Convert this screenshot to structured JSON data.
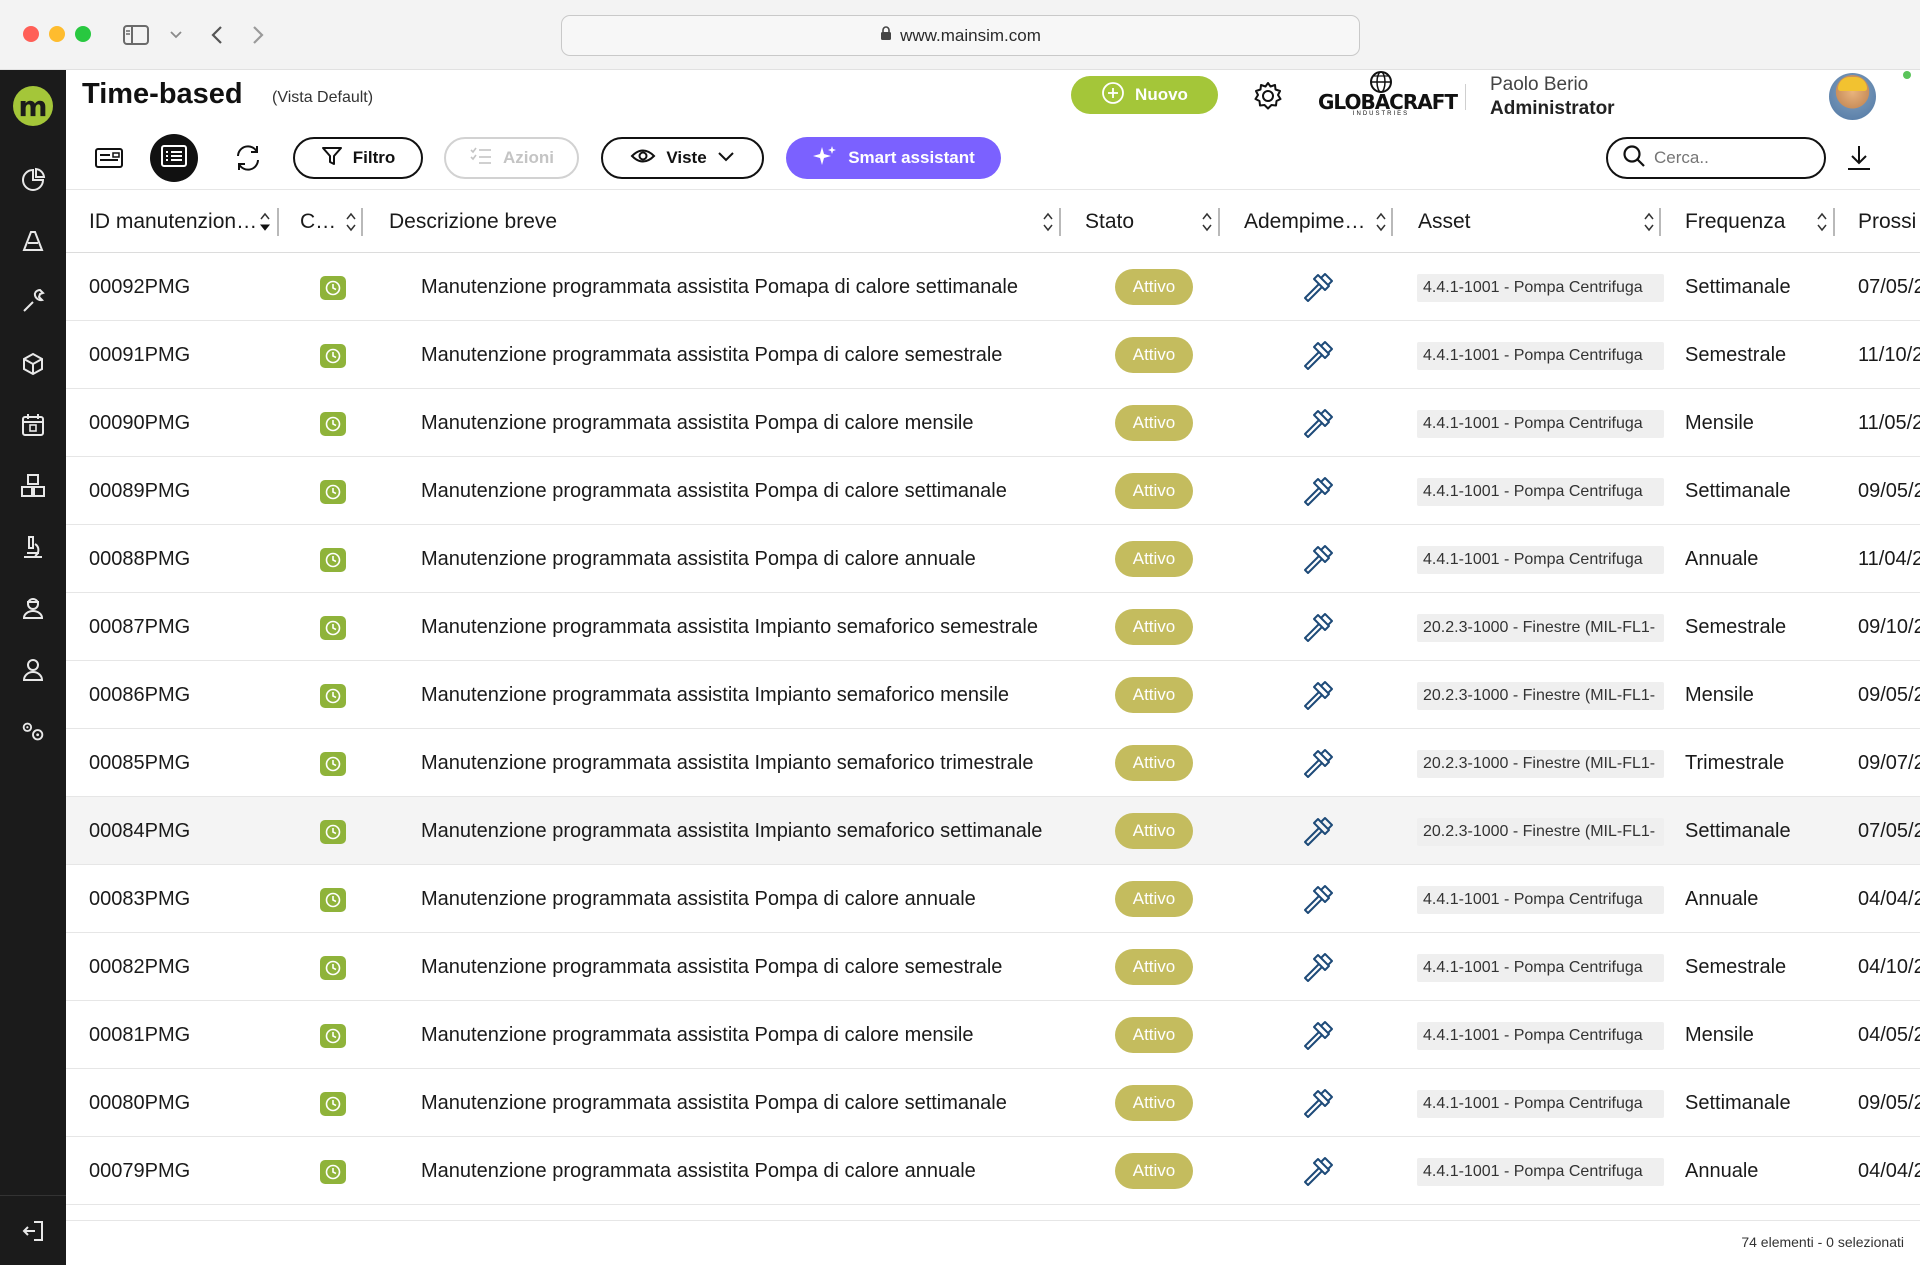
{
  "browser": {
    "url": "www.mainsim.com"
  },
  "sidebar": {
    "logo_letter": "m",
    "items": [
      {
        "icon": "pie-chart-icon"
      },
      {
        "icon": "alert-icon"
      },
      {
        "icon": "wrench-icon"
      },
      {
        "icon": "box-icon"
      },
      {
        "icon": "calendar-icon"
      },
      {
        "icon": "boxes-icon"
      },
      {
        "icon": "microscope-icon"
      },
      {
        "icon": "technician-icon"
      },
      {
        "icon": "user-icon"
      },
      {
        "icon": "settings-gears-icon"
      }
    ],
    "logout_icon": "logout-icon"
  },
  "header": {
    "title": "Time-based",
    "view": "(Vista Default)",
    "new_button": "Nuovo",
    "brand": "GLOBACRAFT",
    "brand_sub": "INDUSTRIES",
    "user_name": "Paolo Berio",
    "user_role": "Administrator"
  },
  "toolbar": {
    "filter_label": "Filtro",
    "actions_label": "Azioni",
    "views_label": "Viste",
    "smart_label": "Smart assistant",
    "search_placeholder": "Cerca.."
  },
  "colors": {
    "accent_green": "#a4c639",
    "status_badge": "#c4bc5e",
    "smart_purple": "#7b61ff",
    "sidebar": "#1b1b1b"
  },
  "table": {
    "columns": [
      "ID manutenzion…",
      "C…",
      "Descrizione breve",
      "Stato",
      "Adempime…",
      "Asset",
      "Frequenza",
      "Prossi"
    ],
    "rows": [
      {
        "id": "00092PMG",
        "desc": "Manutenzione programmata assistita Pomapa di calore settimanale",
        "stato": "Attivo",
        "asset": "4.4.1-1001 - Pompa Centrifuga",
        "freq": "Settimanale",
        "next": "07/05/2"
      },
      {
        "id": "00091PMG",
        "desc": "Manutenzione programmata assistita Pompa di calore semestrale",
        "stato": "Attivo",
        "asset": "4.4.1-1001 - Pompa Centrifuga",
        "freq": "Semestrale",
        "next": "11/10/2"
      },
      {
        "id": "00090PMG",
        "desc": "Manutenzione programmata assistita Pompa di calore mensile",
        "stato": "Attivo",
        "asset": "4.4.1-1001 - Pompa Centrifuga",
        "freq": "Mensile",
        "next": "11/05/2"
      },
      {
        "id": "00089PMG",
        "desc": "Manutenzione programmata assistita Pompa di calore settimanale",
        "stato": "Attivo",
        "asset": "4.4.1-1001 - Pompa Centrifuga",
        "freq": "Settimanale",
        "next": "09/05/2"
      },
      {
        "id": "00088PMG",
        "desc": "Manutenzione programmata assistita Pompa di calore annuale",
        "stato": "Attivo",
        "asset": "4.4.1-1001 - Pompa Centrifuga",
        "freq": "Annuale",
        "next": "11/04/2"
      },
      {
        "id": "00087PMG",
        "desc": "Manutenzione programmata assistita Impianto semaforico semestrale",
        "stato": "Attivo",
        "asset": "20.2.3-1000 - Finestre (MIL-FL1-",
        "freq": "Semestrale",
        "next": "09/10/2"
      },
      {
        "id": "00086PMG",
        "desc": "Manutenzione programmata assistita Impianto semaforico mensile",
        "stato": "Attivo",
        "asset": "20.2.3-1000 - Finestre (MIL-FL1-",
        "freq": "Mensile",
        "next": "09/05/2"
      },
      {
        "id": "00085PMG",
        "desc": "Manutenzione programmata assistita Impianto semaforico trimestrale",
        "stato": "Attivo",
        "asset": "20.2.3-1000 - Finestre (MIL-FL1-",
        "freq": "Trimestrale",
        "next": "09/07/2"
      },
      {
        "id": "00084PMG",
        "desc": "Manutenzione programmata assistita Impianto semaforico settimanale",
        "stato": "Attivo",
        "asset": "20.2.3-1000 - Finestre (MIL-FL1-",
        "freq": "Settimanale",
        "next": "07/05/2"
      },
      {
        "id": "00083PMG",
        "desc": "Manutenzione programmata assistita Pompa di calore annuale",
        "stato": "Attivo",
        "asset": "4.4.1-1001 - Pompa Centrifuga",
        "freq": "Annuale",
        "next": "04/04/2"
      },
      {
        "id": "00082PMG",
        "desc": "Manutenzione programmata assistita Pompa di calore semestrale",
        "stato": "Attivo",
        "asset": "4.4.1-1001 - Pompa Centrifuga",
        "freq": "Semestrale",
        "next": "04/10/2"
      },
      {
        "id": "00081PMG",
        "desc": "Manutenzione programmata assistita Pompa di calore mensile",
        "stato": "Attivo",
        "asset": "4.4.1-1001 - Pompa Centrifuga",
        "freq": "Mensile",
        "next": "04/05/2"
      },
      {
        "id": "00080PMG",
        "desc": "Manutenzione programmata assistita Pompa di calore settimanale",
        "stato": "Attivo",
        "asset": "4.4.1-1001 - Pompa Centrifuga",
        "freq": "Settimanale",
        "next": "09/05/2"
      },
      {
        "id": "00079PMG",
        "desc": "Manutenzione programmata assistita Pompa di calore annuale",
        "stato": "Attivo",
        "asset": "4.4.1-1001 - Pompa Centrifuga",
        "freq": "Annuale",
        "next": "04/04/2"
      }
    ]
  },
  "footer": {
    "summary": "74 elementi - 0 selezionati"
  }
}
